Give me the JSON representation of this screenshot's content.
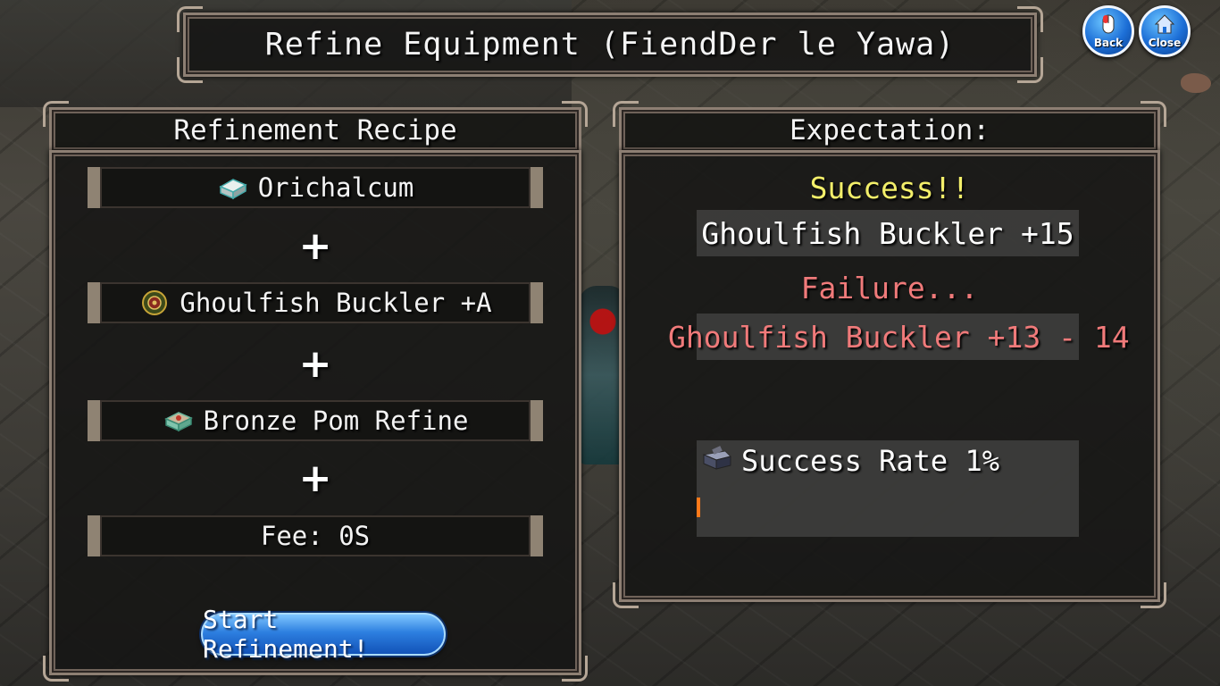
{
  "window": {
    "title": "Refine Equipment (FiendDer le Yawa)"
  },
  "top_buttons": {
    "back_label": "Back",
    "close_label": "Close"
  },
  "recipe": {
    "header": "Refinement Recipe",
    "items": [
      {
        "label": "Orichalcum",
        "icon": "ingot-icon"
      },
      {
        "label": "Ghoulfish Buckler +A",
        "icon": "shield-icon"
      },
      {
        "label": "Bronze Pom Refine",
        "icon": "refine-box-icon"
      }
    ],
    "plus": "+",
    "fee": "Fee: 0S",
    "start_button": "Start Refinement!"
  },
  "expectation": {
    "header": "Expectation:",
    "success_label": "Success!!",
    "success_result": "Ghoulfish Buckler +15",
    "failure_label": "Failure...",
    "failure_result": "Ghoulfish Buckler +13 - 14",
    "success_rate_text": "Success Rate 1%",
    "success_rate_value": 0.01
  },
  "colors": {
    "success": "#f3ef6a",
    "failure": "#f07a7a",
    "rate_bar": "#ff7a1a",
    "button_blue": "#2d7fe0"
  }
}
